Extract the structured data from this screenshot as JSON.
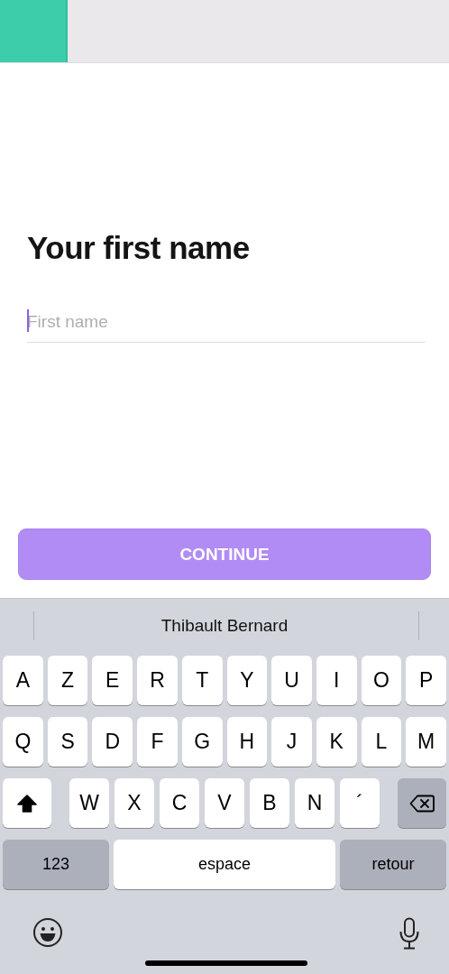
{
  "progress": {
    "level": 0.15
  },
  "title": "Your first name",
  "field": {
    "placeholder": "First name",
    "focused": true
  },
  "continue_button": {
    "label": "CONTINUE",
    "disabled": true
  },
  "keyboard": {
    "suggestion": "Thibault Bernard",
    "rows": [
      {
        "keys": [
          {
            "kind": "letter",
            "label": "A"
          },
          {
            "kind": "letter",
            "label": "Z"
          },
          {
            "kind": "letter",
            "label": "E"
          },
          {
            "kind": "letter",
            "label": "R"
          },
          {
            "kind": "letter",
            "label": "T"
          },
          {
            "kind": "letter",
            "label": "Y"
          },
          {
            "kind": "letter",
            "label": "U"
          },
          {
            "kind": "letter",
            "label": "I"
          },
          {
            "kind": "letter",
            "label": "O"
          },
          {
            "kind": "letter",
            "label": "P"
          }
        ]
      },
      {
        "keys": [
          {
            "kind": "letter",
            "label": "Q"
          },
          {
            "kind": "letter",
            "label": "S"
          },
          {
            "kind": "letter",
            "label": "D"
          },
          {
            "kind": "letter",
            "label": "F"
          },
          {
            "kind": "letter",
            "label": "G"
          },
          {
            "kind": "letter",
            "label": "H"
          },
          {
            "kind": "letter",
            "label": "J"
          },
          {
            "kind": "letter",
            "label": "K"
          },
          {
            "kind": "letter",
            "label": "L"
          },
          {
            "kind": "letter",
            "label": "M"
          }
        ]
      },
      {
        "keys": [
          {
            "kind": "shift",
            "on": true
          },
          {
            "kind": "letter",
            "label": "W"
          },
          {
            "kind": "letter",
            "label": "X"
          },
          {
            "kind": "letter",
            "label": "C"
          },
          {
            "kind": "letter",
            "label": "V"
          },
          {
            "kind": "letter",
            "label": "B"
          },
          {
            "kind": "letter",
            "label": "N"
          },
          {
            "kind": "letter",
            "label": "´"
          },
          {
            "kind": "delete"
          }
        ]
      },
      {
        "keys": [
          {
            "kind": "numbers",
            "label": "123"
          },
          {
            "kind": "space",
            "label": "espace"
          },
          {
            "kind": "return",
            "label": "retour"
          }
        ]
      }
    ]
  }
}
